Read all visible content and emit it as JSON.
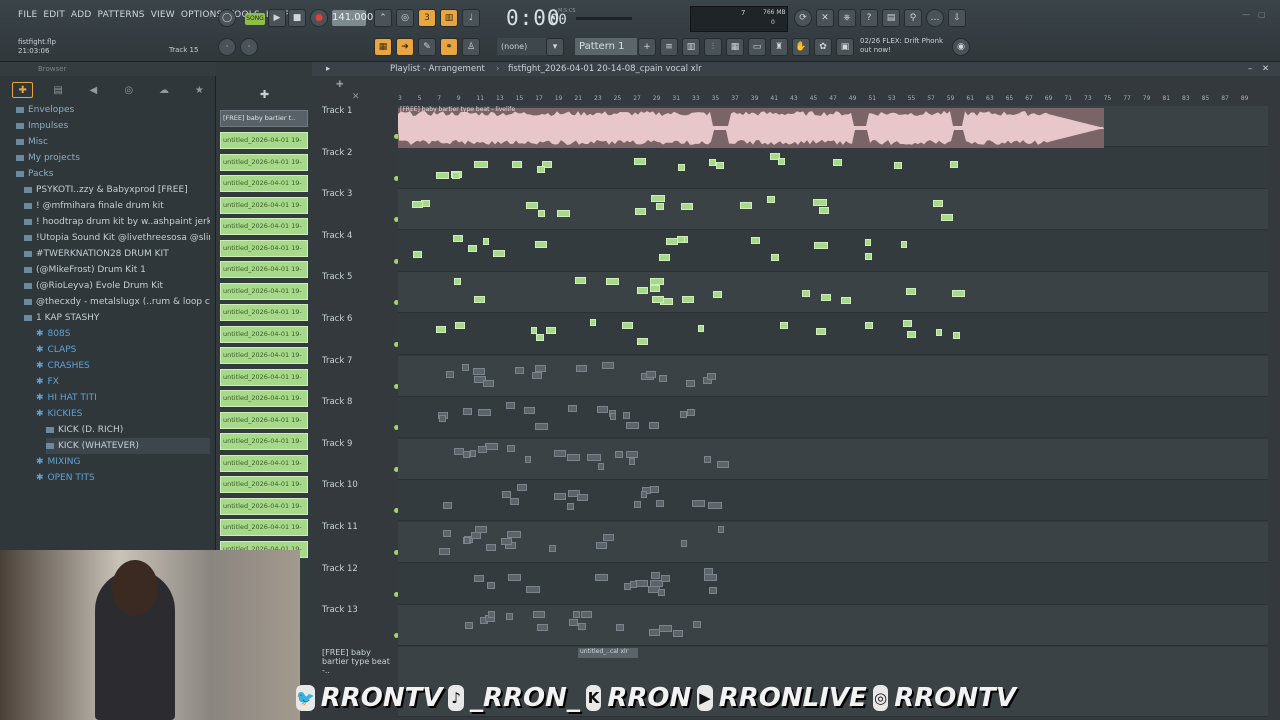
{
  "menu": [
    "FILE",
    "EDIT",
    "ADD",
    "PATTERNS",
    "VIEW",
    "OPTIONS",
    "TOOLS",
    "HELP"
  ],
  "transport": {
    "mode_label": "SONG",
    "tempo": "141.000",
    "time": "0:00",
    "time_small": "00",
    "time_unit": "M:S:CS",
    "monitor_value": "7",
    "memory": "766 MB",
    "memory_sub": "0"
  },
  "pattern": {
    "selector": "Pattern 1",
    "preset": "(none)"
  },
  "file": {
    "name": "fistfight.flp",
    "time": "21:03:06",
    "track_hint": "Track 15"
  },
  "news": {
    "line1": "02/26  FLEX: Drift Phonk",
    "line2": "out now!"
  },
  "browser": {
    "title": "Browser",
    "items": [
      {
        "label": "Envelopes",
        "kind": "folder"
      },
      {
        "label": "Impulses",
        "kind": "folder"
      },
      {
        "label": "Misc",
        "kind": "folder"
      },
      {
        "label": "My projects",
        "kind": "folder"
      },
      {
        "label": "Packs",
        "kind": "folder"
      },
      {
        "label": "PSYKOTI..zzy & Babyxprod [FREE]",
        "kind": "pack"
      },
      {
        "label": "!  @mfmihara finale drum kit",
        "kind": "pack"
      },
      {
        "label": "! hoodtrap drum kit by w..ashpaint jerk kit) (1)",
        "kind": "pack"
      },
      {
        "label": "!Utopia Sound Kit @livethreesosa @slimejax",
        "kind": "pack"
      },
      {
        "label": "#TWERKNATION28 DRUM KIT",
        "kind": "pack"
      },
      {
        "label": "(@MikeFrost) Drum Kit 1",
        "kind": "pack"
      },
      {
        "label": "(@RioLeyva) Evole Drum Kit",
        "kind": "pack"
      },
      {
        "label": "@thecxdy - metalslugx (..rum & loop collection)",
        "kind": "pack"
      },
      {
        "label": "1 KAP STASHY",
        "kind": "pack-open"
      },
      {
        "label": "808S",
        "kind": "sub"
      },
      {
        "label": "CLAPS",
        "kind": "sub"
      },
      {
        "label": "CRASHES",
        "kind": "sub"
      },
      {
        "label": "FX",
        "kind": "sub"
      },
      {
        "label": "HI HAT TITI",
        "kind": "sub"
      },
      {
        "label": "KICKIES",
        "kind": "sub-open"
      },
      {
        "label": "KICK (D. RICH)",
        "kind": "file"
      },
      {
        "label": "KICK (WHATEVER)",
        "kind": "file-sel"
      },
      {
        "label": "MIXING",
        "kind": "sub"
      },
      {
        "label": "OPEN TITS",
        "kind": "sub"
      }
    ]
  },
  "channels": {
    "first": "[FREE] baby bartier t..",
    "clips": [
      "untitled_2026-04-01 19-",
      "untitled_2026-04-01 19-",
      "untitled_2026-04-01 19-",
      "untitled_2026-04-01 19-",
      "untitled_2026-04-01 19-",
      "untitled_2026-04-01 19-",
      "untitled_2026-04-01 19-",
      "untitled_2026-04-01 19-",
      "untitled_2026-04-01 19-",
      "untitled_2026-04-01 19-",
      "untitled_2026-04-01 19-",
      "untitled_2026-04-01 19-",
      "untitled_2026-04-01 19-",
      "untitled_2026-04-01 19-",
      "untitled_2026-04-01 19-",
      "untitled_2026-04-01 19-",
      "untitled_2026-04-01 19-",
      "untitled_2026-04-01 19-",
      "untitled_2026-04-01 19-",
      "untitled_2026-04-01 19-"
    ]
  },
  "playlist": {
    "title": "Playlist - Arrangement",
    "project": "fistfight_2026-04-01 20-14-08_cpain vocal xlr",
    "audio_clip": "[FREE] baby bartier type beat - livelife",
    "bottom_clip": "[FREE] baby bartier type beat -..",
    "bottom_clip2": "untitled_..cal xlr",
    "ruler": [
      "3",
      "5",
      "7",
      "9",
      "11",
      "13",
      "15",
      "17",
      "19",
      "21",
      "23",
      "25",
      "27",
      "29",
      "31",
      "33",
      "35",
      "37",
      "39",
      "41",
      "43",
      "45",
      "47",
      "49",
      "51",
      "53",
      "55",
      "57",
      "59",
      "61",
      "63",
      "65",
      "67",
      "69",
      "71",
      "73",
      "75",
      "77",
      "79",
      "81",
      "83",
      "85",
      "87",
      "89"
    ],
    "tracks": [
      "Track 1",
      "Track 2",
      "Track 3",
      "Track 4",
      "Track 5",
      "Track 6",
      "Track 7",
      "Track 8",
      "Track 9",
      "Track 10",
      "Track 11",
      "Track 12",
      "Track 13"
    ]
  },
  "overlay": {
    "handles": [
      {
        "icon": "twitter-icon",
        "glyph": "🐦",
        "name": "RRONTV"
      },
      {
        "icon": "tiktok-icon",
        "glyph": "♪",
        "name": "_RRON_"
      },
      {
        "icon": "kick-icon",
        "glyph": "K",
        "name": "RRON"
      },
      {
        "icon": "youtube-icon",
        "glyph": "▶",
        "name": "RRONLIVE"
      },
      {
        "icon": "instagram-icon",
        "glyph": "◎",
        "name": "RRONTV"
      }
    ]
  },
  "colors": {
    "accent": "#e8a640",
    "clip": "#a7d98a",
    "folder": "#5ea3d6",
    "audio": "#7a6467"
  }
}
